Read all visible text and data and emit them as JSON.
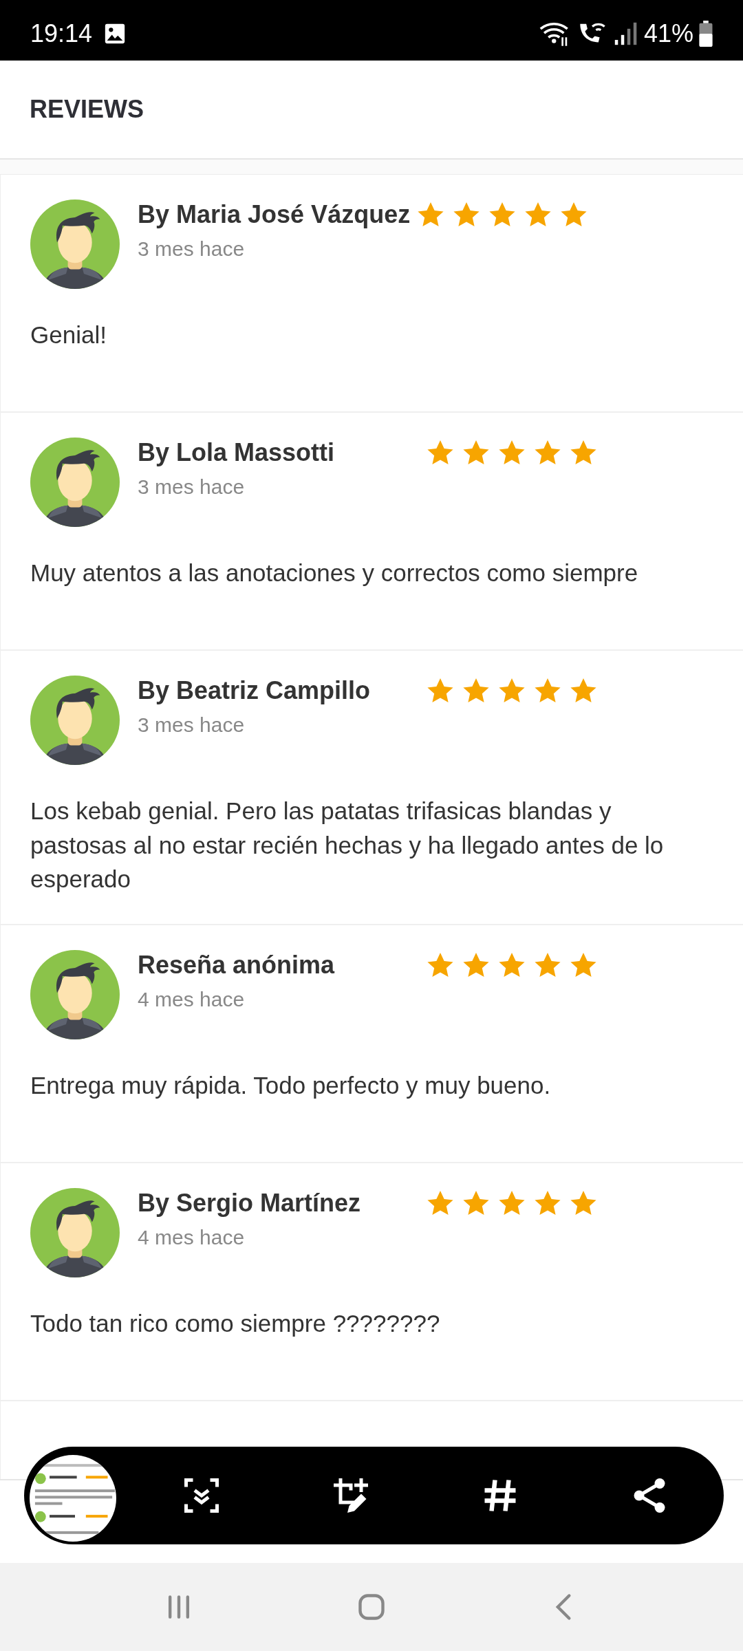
{
  "status_bar": {
    "time": "19:14",
    "battery": "41%"
  },
  "header": {
    "title": "REVIEWS"
  },
  "reviews": [
    {
      "author": "By Maria José Vázquez",
      "time": "3 mes hace",
      "stars": 5,
      "text": "Genial!"
    },
    {
      "author": "By Lola Massotti",
      "time": "3 mes hace",
      "stars": 5,
      "text": "Muy atentos a las anotaciones y correctos como siempre"
    },
    {
      "author": "By Beatriz Campillo",
      "time": "3 mes hace",
      "stars": 5,
      "text": "Los kebab genial. Pero las patatas trifasicas blandas y pastosas al no estar recién hechas y ha llegado antes de lo esperado"
    },
    {
      "author": "Reseña anónima",
      "time": "4 mes hace",
      "stars": 5,
      "text": "Entrega muy rápida. Todo perfecto y muy bueno."
    },
    {
      "author": "By Sergio Martínez",
      "time": "4 mes hace",
      "stars": 5,
      "text": "Todo tan rico como siempre ????????"
    }
  ]
}
